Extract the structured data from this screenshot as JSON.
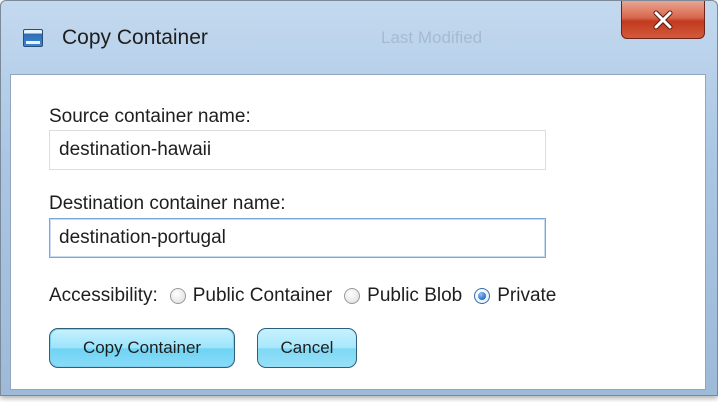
{
  "window": {
    "title": "Copy Container",
    "background_title": "Last Modified",
    "close_icon": "close-x-icon"
  },
  "form": {
    "source_label": "Source container name:",
    "source_value": "destination-hawaii",
    "destination_label": "Destination container name:",
    "destination_value": "destination-portugal",
    "accessibility_label": "Accessibility:",
    "accessibility_options": [
      {
        "label": "Public Container",
        "checked": false
      },
      {
        "label": "Public Blob",
        "checked": false
      },
      {
        "label": "Private",
        "checked": true
      }
    ]
  },
  "buttons": {
    "copy_label": "Copy Container",
    "cancel_label": "Cancel"
  },
  "colors": {
    "button_fill": "#9be4fb",
    "close_button": "#c13a1f",
    "radio_selected": "#2b6fc2"
  }
}
